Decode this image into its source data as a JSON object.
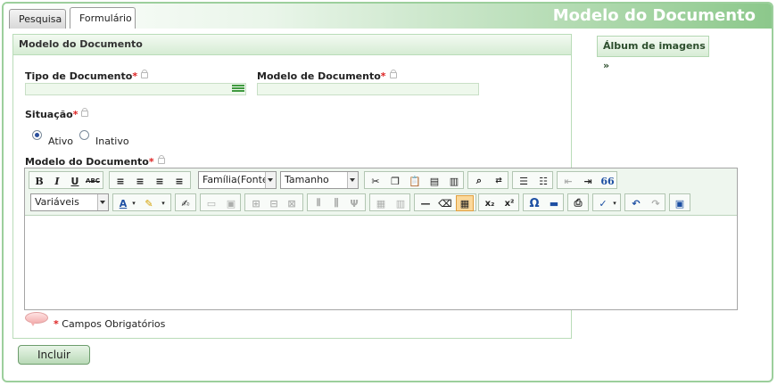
{
  "tabs": [
    {
      "label": "Pesquisa"
    },
    {
      "label": "Formulário"
    }
  ],
  "page_title": "Modelo do Documento",
  "panel": {
    "header": "Modelo do Documento"
  },
  "album_button": "Álbum de imagens »",
  "fields": {
    "tipo_documento": {
      "label": "Tipo de Documento",
      "required_mark": "*",
      "value": ""
    },
    "modelo_documento": {
      "label": "Modelo de Documento",
      "required_mark": "*",
      "value": ""
    },
    "situacao": {
      "label": "Situação",
      "required_mark": "*",
      "options": [
        {
          "label": "Ativo",
          "selected": true
        },
        {
          "label": "Inativo",
          "selected": false
        }
      ]
    },
    "modelo_texto": {
      "label": "Modelo do Documento",
      "required_mark": "*"
    }
  },
  "editor": {
    "font_family_select": "Família(Fonte)",
    "font_size_select": "Tamanho",
    "variables_select": "Variáveis",
    "bold": "B",
    "italic": "I",
    "underline": "U",
    "strike": "ABC",
    "quote": "66",
    "subscript": "x₂",
    "superscript": "x²",
    "omega": "Ω"
  },
  "footnote": {
    "mark": "*",
    "text": "Campos Obrigatórios"
  },
  "submit_button": "Incluir",
  "colors": {
    "accent_green": "#8cc88b",
    "required_red": "#d22222",
    "panel_border": "#b9dcb8"
  }
}
